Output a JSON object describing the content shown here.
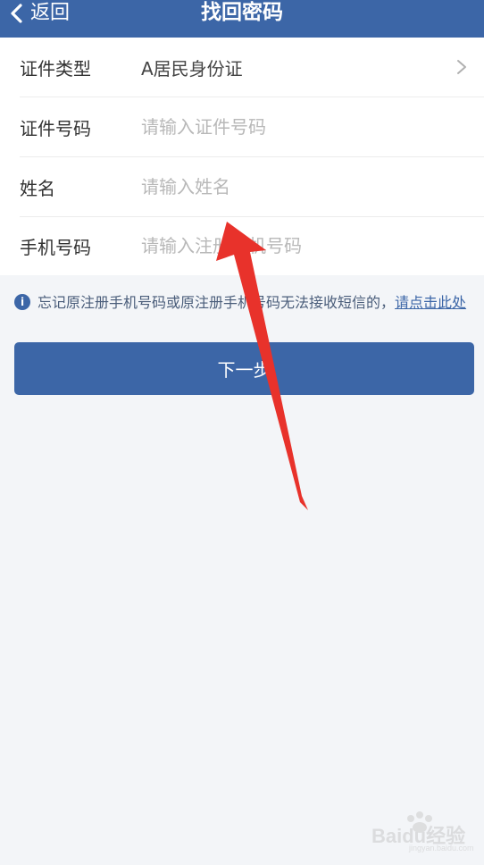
{
  "header": {
    "back_label": "返回",
    "title": "找回密码"
  },
  "form": {
    "rows": [
      {
        "label": "证件类型",
        "value": "A居民身份证"
      },
      {
        "label": "证件号码",
        "placeholder": "请输入证件号码"
      },
      {
        "label": "姓名",
        "placeholder": "请输入姓名"
      },
      {
        "label": "手机号码",
        "placeholder": "请输入注册手机号码"
      }
    ]
  },
  "notice": {
    "text": "忘记原注册手机号码或原注册手机号码无法接收短信的，",
    "link_text": "请点击此处"
  },
  "next_button": {
    "label": "下一步"
  },
  "watermark": {
    "brand": "Baidu经验",
    "domain": "jingyan.baidu.com"
  },
  "colors": {
    "primary": "#3c66a7",
    "background": "#f3f5f8",
    "annotation_arrow": "#e8322b"
  }
}
